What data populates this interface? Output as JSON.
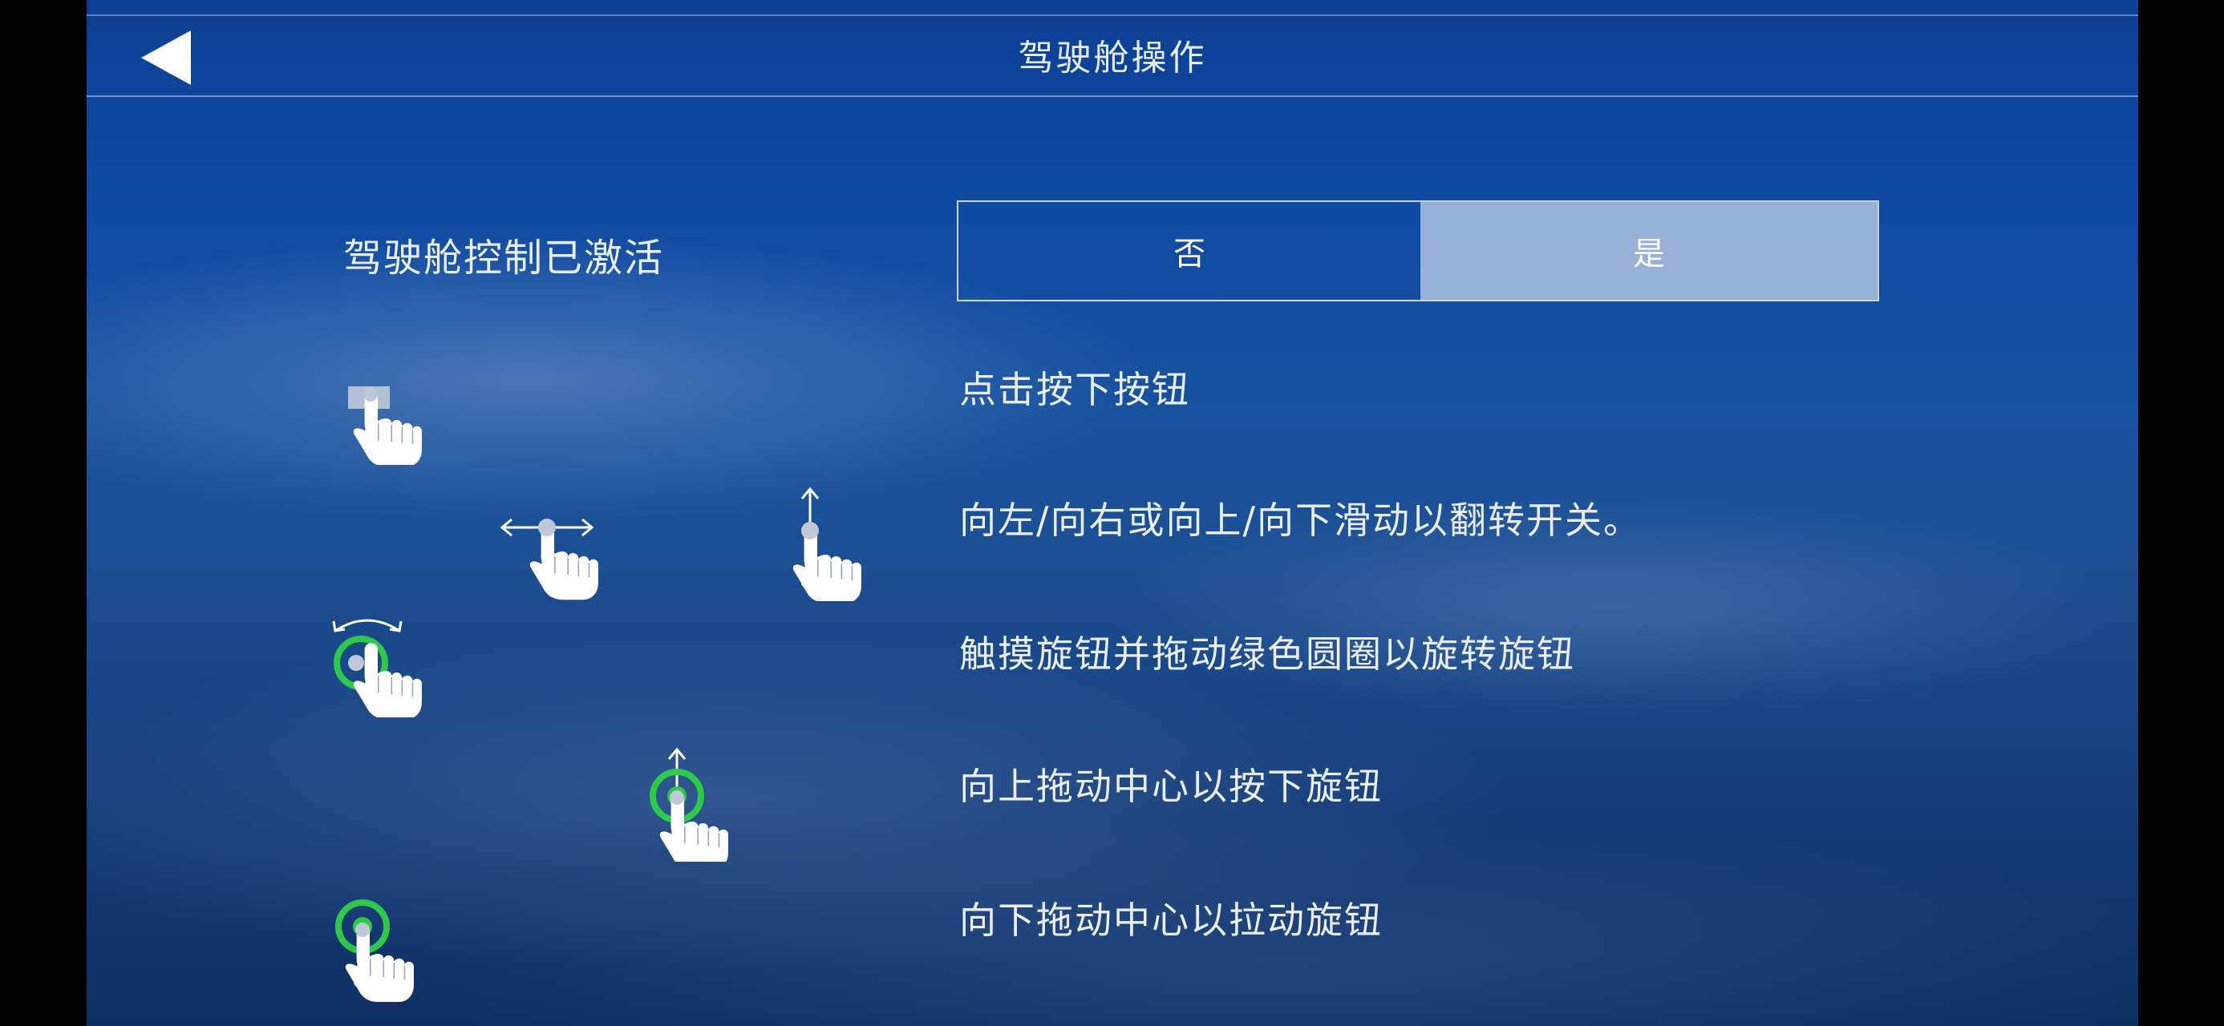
{
  "header": {
    "title": "驾驶舱操作"
  },
  "settings": {
    "cockpit_control_label": "驾驶舱控制已激活",
    "options": [
      "否",
      "是"
    ],
    "selected": "是"
  },
  "instructions": [
    "点击按下按钮",
    "向左/向右或向上/向下滑动以翻转开关。",
    "触摸旋钮并拖动绿色圆圈以旋转旋钮",
    "向上拖动中心以按下旋钮",
    "向下拖动中心以拉动旋钮"
  ],
  "icons": {
    "back": "back-arrow-icon",
    "tap": "tap-gesture-icon",
    "swipe_horizontal": "swipe-horizontal-icon",
    "swipe_vertical": "swipe-vertical-icon",
    "rotate": "rotate-knob-icon",
    "push": "push-knob-icon",
    "pull": "pull-knob-icon"
  },
  "colors": {
    "background": "#114a9f",
    "accent_green": "#2ec94a",
    "selected_segment": "#bfcde8",
    "text": "#e9eef8"
  }
}
